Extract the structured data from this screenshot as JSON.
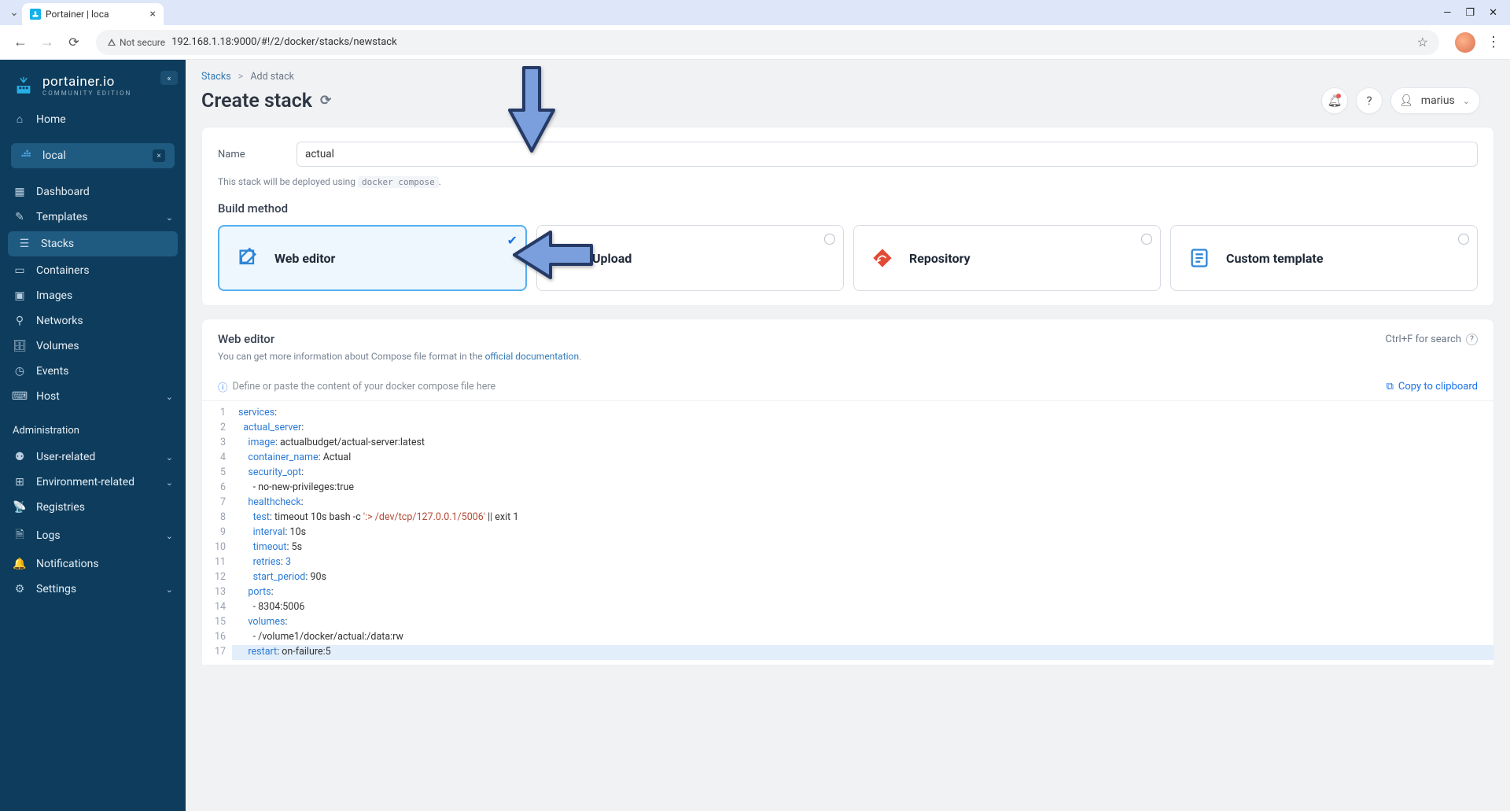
{
  "browser": {
    "tab_title": "Portainer | loca",
    "security_label": "Not secure",
    "url": "192.168.1.18:9000/#!/2/docker/stacks/newstack"
  },
  "sidebar": {
    "brand": "portainer.io",
    "edition": "COMMUNITY EDITION",
    "home": "Home",
    "env_name": "local",
    "items": [
      {
        "icon": "dashboard",
        "label": "Dashboard"
      },
      {
        "icon": "templates",
        "label": "Templates",
        "expandable": true
      },
      {
        "icon": "stacks",
        "label": "Stacks",
        "active": true
      },
      {
        "icon": "containers",
        "label": "Containers"
      },
      {
        "icon": "images",
        "label": "Images"
      },
      {
        "icon": "networks",
        "label": "Networks"
      },
      {
        "icon": "volumes",
        "label": "Volumes"
      },
      {
        "icon": "events",
        "label": "Events"
      },
      {
        "icon": "host",
        "label": "Host",
        "expandable": true
      }
    ],
    "admin_header": "Administration",
    "admin_items": [
      {
        "icon": "users",
        "label": "User-related",
        "expandable": true
      },
      {
        "icon": "env",
        "label": "Environment-related",
        "expandable": true
      },
      {
        "icon": "registries",
        "label": "Registries"
      },
      {
        "icon": "logs",
        "label": "Logs",
        "expandable": true
      },
      {
        "icon": "notifications",
        "label": "Notifications"
      },
      {
        "icon": "settings",
        "label": "Settings",
        "expandable": true
      }
    ]
  },
  "breadcrumb": {
    "root": "Stacks",
    "leaf": "Add stack"
  },
  "page": {
    "title": "Create stack",
    "username": "marius"
  },
  "form": {
    "name_label": "Name",
    "name_value": "actual",
    "deploy_note_pre": "This stack will be deployed using ",
    "deploy_note_code": "docker compose",
    "deploy_note_post": "."
  },
  "build": {
    "section": "Build method",
    "methods": [
      {
        "id": "web-editor",
        "label": "Web editor",
        "selected": true,
        "color": "#2f86d6"
      },
      {
        "id": "upload",
        "label": "Upload",
        "selected": false,
        "color": "#2f86d6"
      },
      {
        "id": "repository",
        "label": "Repository",
        "selected": false,
        "color": "#e24a33"
      },
      {
        "id": "custom-template",
        "label": "Custom template",
        "selected": false,
        "color": "#2f86d6"
      }
    ]
  },
  "editor": {
    "title": "Web editor",
    "search_hint": "Ctrl+F for search",
    "sub_pre": "You can get more information about Compose file format in the ",
    "sub_link": "official documentation",
    "sub_post": ".",
    "hint": "Define or paste the content of your docker compose file here",
    "copy": "Copy to clipboard",
    "lines": [
      {
        "n": 1,
        "segs": [
          [
            "k",
            "services"
          ],
          [
            "p",
            ":"
          ]
        ]
      },
      {
        "n": 2,
        "segs": [
          [
            "p",
            "  "
          ],
          [
            "k",
            "actual_server"
          ],
          [
            "p",
            ":"
          ]
        ]
      },
      {
        "n": 3,
        "segs": [
          [
            "p",
            "    "
          ],
          [
            "k",
            "image"
          ],
          [
            "p",
            ": actualbudget/actual-server:latest"
          ]
        ]
      },
      {
        "n": 4,
        "segs": [
          [
            "p",
            "    "
          ],
          [
            "k",
            "container_name"
          ],
          [
            "p",
            ": Actual"
          ]
        ]
      },
      {
        "n": 5,
        "segs": [
          [
            "p",
            "    "
          ],
          [
            "k",
            "security_opt"
          ],
          [
            "p",
            ":"
          ]
        ]
      },
      {
        "n": 6,
        "segs": [
          [
            "p",
            "      - no-new-privileges:true"
          ]
        ]
      },
      {
        "n": 7,
        "segs": [
          [
            "p",
            "    "
          ],
          [
            "k",
            "healthcheck"
          ],
          [
            "p",
            ":"
          ]
        ]
      },
      {
        "n": 8,
        "segs": [
          [
            "p",
            "      "
          ],
          [
            "k",
            "test"
          ],
          [
            "p",
            ": timeout 10s bash -c "
          ],
          [
            "s",
            "':> /dev/tcp/127.0.0.1/5006'"
          ],
          [
            "p",
            " || exit 1"
          ]
        ]
      },
      {
        "n": 9,
        "segs": [
          [
            "p",
            "      "
          ],
          [
            "k",
            "interval"
          ],
          [
            "p",
            ": 10s"
          ]
        ]
      },
      {
        "n": 10,
        "segs": [
          [
            "p",
            "      "
          ],
          [
            "k",
            "timeout"
          ],
          [
            "p",
            ": 5s"
          ]
        ]
      },
      {
        "n": 11,
        "segs": [
          [
            "p",
            "      "
          ],
          [
            "k",
            "retries"
          ],
          [
            "p",
            ": "
          ],
          [
            "k",
            "3"
          ]
        ]
      },
      {
        "n": 12,
        "segs": [
          [
            "p",
            "      "
          ],
          [
            "k",
            "start_period"
          ],
          [
            "p",
            ": 90s"
          ]
        ]
      },
      {
        "n": 13,
        "segs": [
          [
            "p",
            "    "
          ],
          [
            "k",
            "ports"
          ],
          [
            "p",
            ":"
          ]
        ]
      },
      {
        "n": 14,
        "segs": [
          [
            "p",
            "      - 8304:5006"
          ]
        ]
      },
      {
        "n": 15,
        "segs": [
          [
            "p",
            "    "
          ],
          [
            "k",
            "volumes"
          ],
          [
            "p",
            ":"
          ]
        ]
      },
      {
        "n": 16,
        "segs": [
          [
            "p",
            "      - /volume1/docker/actual:/data:rw"
          ]
        ]
      },
      {
        "n": 17,
        "hl": true,
        "segs": [
          [
            "p",
            "    "
          ],
          [
            "k",
            "restart"
          ],
          [
            "p",
            ": on-failure:5"
          ]
        ]
      }
    ]
  }
}
